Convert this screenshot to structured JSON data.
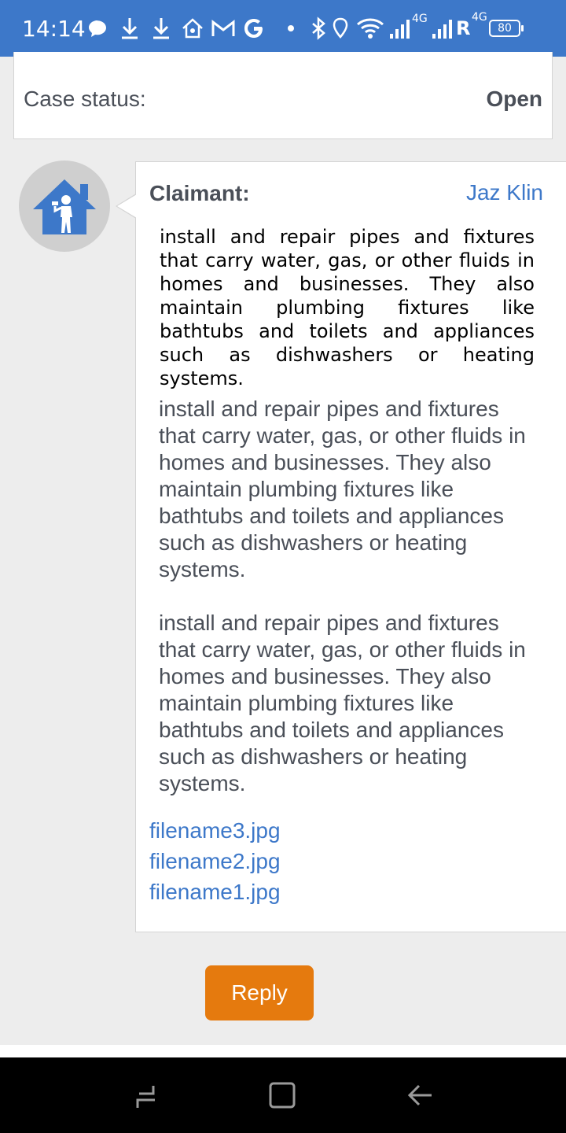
{
  "status_bar": {
    "time": "14:14",
    "network_label": "4G",
    "roaming_label": "R",
    "network_label_2": "4G",
    "battery": "80"
  },
  "case": {
    "status_label": "Case status:",
    "status_value": "Open"
  },
  "message": {
    "sender_label": "Claimant:",
    "sender_name": "Jaz Klin",
    "paragraphs": [
      "install and repair pipes and fixtures that carry water, gas, or other fluids in homes and businesses. They also maintain plumbing fixtures like bathtubs and toilets and appliances such as dishwashers or heating systems.",
      "install and repair pipes and fixtures that carry water, gas, or other fluids in homes and businesses. They also maintain plumbing fixtures like bathtubs and toilets and appliances such as dishwashers or heating systems.",
      "install and repair pipes and fixtures that carry water, gas, or other fluids in homes and businesses. They also maintain plumbing fixtures like bathtubs and toilets and appliances such as dishwashers or heating systems."
    ],
    "attachments": [
      "filename3.jpg",
      "filename2.jpg",
      "filename1.jpg"
    ]
  },
  "actions": {
    "reply_label": "Reply"
  },
  "colors": {
    "accent": "#3d78c9",
    "button": "#e57a0e"
  }
}
